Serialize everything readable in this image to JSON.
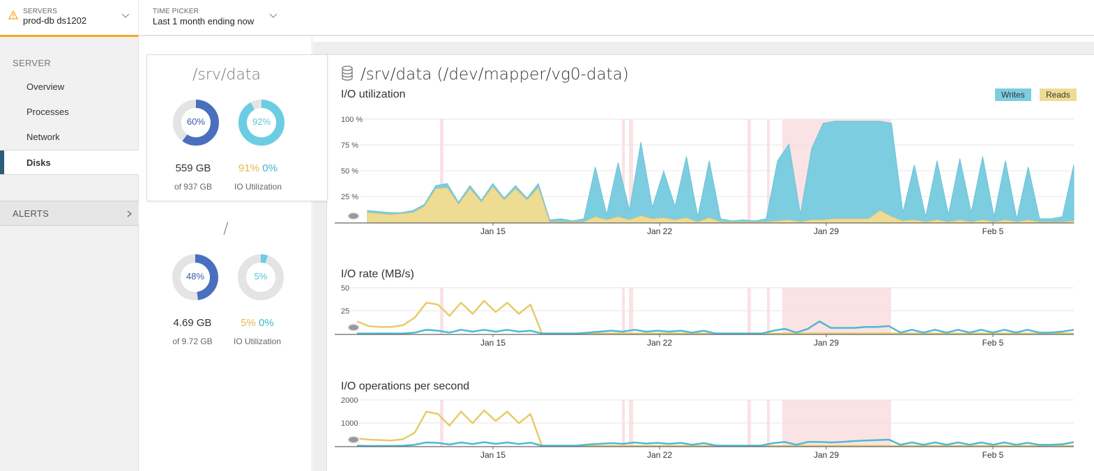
{
  "topbar": {
    "servers_label": "SERVERS",
    "servers_value": "prod-db ds1202",
    "time_label": "TIME PICKER",
    "time_value": "Last 1 month ending now"
  },
  "sidebar": {
    "section": "SERVER",
    "items": [
      {
        "label": "Overview"
      },
      {
        "label": "Processes"
      },
      {
        "label": "Network"
      },
      {
        "label": "Disks"
      }
    ],
    "alerts": "ALERTS"
  },
  "disks": [
    {
      "name": "/srv/data",
      "space_pct": "60%",
      "space_value": 0.6,
      "io_pct": "92%",
      "io_value": 0.92,
      "used": "559 GB",
      "total": "of 937 GB",
      "reads_pct": "91%",
      "writes_pct": "0%",
      "io_label": "IO Utilization"
    },
    {
      "name": "/",
      "space_pct": "48%",
      "space_value": 0.48,
      "io_pct": "5%",
      "io_value": 0.05,
      "used": "4.69 GB",
      "total": "of 9.72 GB",
      "reads_pct": "5%",
      "writes_pct": "0%",
      "io_label": "IO Utilization"
    }
  ],
  "main": {
    "title": "/srv/data (/dev/mapper/vg0-data)",
    "legend": {
      "writes": "Writes",
      "reads": "Reads"
    }
  },
  "colors": {
    "writes": "#7ccde0",
    "writes_line": "#4fb8d3",
    "reads": "#efdc93",
    "reads_line": "#e5cc6a",
    "alert": "#fbe2e4",
    "donut_space": "#4a6fbf",
    "donut_io": "#6bcde3"
  },
  "x_labels": [
    "Jan 15",
    "Jan 22",
    "Jan 29",
    "Feb 5"
  ],
  "chart_data": [
    {
      "type": "area",
      "title": "I/O utilization",
      "y_ticks": [
        "100 %",
        "75 %",
        "50 %",
        "25 %"
      ],
      "ylim": [
        0,
        100
      ],
      "xlim": [
        "Jan 8",
        "Feb 8"
      ],
      "series": [
        {
          "name": "Writes",
          "x": [
            0,
            0.5,
            1,
            1.5,
            2,
            2.5,
            3,
            3.5,
            4,
            4.5,
            5,
            5.5,
            6,
            6.5,
            7,
            7.5,
            8,
            8.5,
            9,
            9.5,
            10,
            10.5,
            11,
            11.5,
            12,
            12.5,
            13,
            13.5,
            14,
            14.5,
            15,
            15.5,
            16,
            16.5,
            17,
            17.5,
            18,
            18.5,
            19,
            19.5,
            20,
            20.5,
            21,
            21.5,
            22,
            22.5,
            23,
            23.5,
            24,
            24.5,
            25,
            25.5,
            26,
            26.5,
            27,
            27.5,
            28,
            28.5,
            29,
            29.5,
            30,
            30.5,
            31
          ],
          "values": [
            12,
            11,
            10,
            10,
            12,
            18,
            36,
            38,
            20,
            36,
            22,
            38,
            24,
            36,
            24,
            38,
            3,
            4,
            2,
            4,
            54,
            8,
            58,
            12,
            78,
            15,
            50,
            16,
            64,
            6,
            60,
            4,
            2,
            3,
            2,
            4,
            60,
            76,
            8,
            72,
            96,
            98,
            98,
            98,
            98,
            98,
            96,
            10,
            56,
            6,
            60,
            8,
            62,
            10,
            64,
            6,
            60,
            4,
            54,
            4,
            4,
            6,
            56
          ]
        },
        {
          "name": "Reads",
          "x": [
            0,
            0.5,
            1,
            1.5,
            2,
            2.5,
            3,
            3.5,
            4,
            4.5,
            5,
            5.5,
            6,
            6.5,
            7,
            7.5,
            8,
            8.5,
            9,
            9.5,
            10,
            10.5,
            11,
            11.5,
            12,
            12.5,
            13,
            13.5,
            14,
            14.5,
            15,
            15.5,
            16,
            16.5,
            17,
            17.5,
            18,
            18.5,
            19,
            19.5,
            20,
            20.5,
            21,
            21.5,
            22,
            22.5,
            23,
            23.5,
            24,
            24.5,
            25,
            25.5,
            26,
            26.5,
            27,
            27.5,
            28,
            28.5,
            29,
            29.5,
            30,
            30.5,
            31
          ],
          "values": [
            10,
            9,
            8,
            9,
            10,
            16,
            33,
            34,
            18,
            33,
            20,
            35,
            22,
            33,
            22,
            34,
            1,
            1,
            1,
            1,
            6,
            3,
            6,
            3,
            7,
            4,
            5,
            3,
            5,
            1,
            5,
            1,
            1,
            1,
            1,
            1,
            2,
            3,
            1,
            3,
            3,
            4,
            4,
            4,
            4,
            12,
            6,
            2,
            3,
            1,
            3,
            1,
            3,
            1,
            3,
            1,
            3,
            1,
            3,
            1,
            1,
            1,
            2
          ]
        }
      ]
    },
    {
      "type": "line",
      "title": "I/O rate (MB/s)",
      "y_ticks": [
        "50",
        "25"
      ],
      "ylim": [
        0,
        50
      ],
      "series": [
        {
          "name": "Writes",
          "values": [
            1,
            1,
            1,
            1,
            1,
            2,
            5,
            4,
            2,
            5,
            3,
            5,
            3,
            5,
            3,
            4,
            1,
            1,
            1,
            1,
            2,
            3,
            4,
            3,
            5,
            3,
            4,
            3,
            4,
            2,
            4,
            1,
            1,
            1,
            1,
            1,
            4,
            6,
            2,
            6,
            14,
            7,
            7,
            7,
            8,
            8,
            9,
            2,
            5,
            2,
            5,
            2,
            5,
            2,
            5,
            2,
            5,
            2,
            5,
            2,
            2,
            3,
            5
          ]
        },
        {
          "name": "Reads",
          "values": [
            14,
            9,
            8,
            8,
            10,
            18,
            34,
            32,
            20,
            34,
            22,
            36,
            24,
            34,
            22,
            32,
            1,
            1,
            1,
            1,
            1,
            1,
            1,
            1,
            1,
            1,
            1,
            1,
            1,
            1,
            1,
            1,
            1,
            1,
            1,
            1,
            1,
            1,
            1,
            1,
            1,
            1,
            1,
            1,
            1,
            1,
            1,
            1,
            1,
            1,
            1,
            1,
            1,
            1,
            1,
            1,
            1,
            1,
            1,
            1,
            1,
            1,
            1
          ]
        }
      ]
    },
    {
      "type": "line",
      "title": "I/O operations per second",
      "y_ticks": [
        "2000",
        "1000"
      ],
      "ylim": [
        0,
        2000
      ],
      "series": [
        {
          "name": "Writes",
          "values": [
            40,
            30,
            30,
            30,
            40,
            80,
            180,
            160,
            90,
            180,
            110,
            190,
            120,
            180,
            110,
            170,
            40,
            40,
            40,
            40,
            90,
            120,
            150,
            120,
            180,
            130,
            160,
            120,
            160,
            80,
            150,
            50,
            40,
            40,
            40,
            50,
            150,
            200,
            80,
            200,
            200,
            180,
            200,
            240,
            260,
            280,
            300,
            80,
            180,
            80,
            180,
            80,
            180,
            80,
            180,
            80,
            180,
            80,
            160,
            80,
            80,
            100,
            190
          ]
        },
        {
          "name": "Reads",
          "values": [
            350,
            300,
            280,
            260,
            320,
            600,
            1500,
            1400,
            900,
            1500,
            1000,
            1550,
            1100,
            1500,
            1000,
            1400,
            30,
            30,
            30,
            30,
            30,
            30,
            30,
            30,
            30,
            30,
            30,
            30,
            30,
            30,
            30,
            30,
            30,
            30,
            30,
            30,
            30,
            30,
            30,
            30,
            30,
            30,
            30,
            30,
            30,
            30,
            30,
            30,
            30,
            30,
            30,
            30,
            30,
            30,
            30,
            30,
            30,
            30,
            30,
            30,
            30,
            30,
            30
          ]
        }
      ]
    }
  ]
}
